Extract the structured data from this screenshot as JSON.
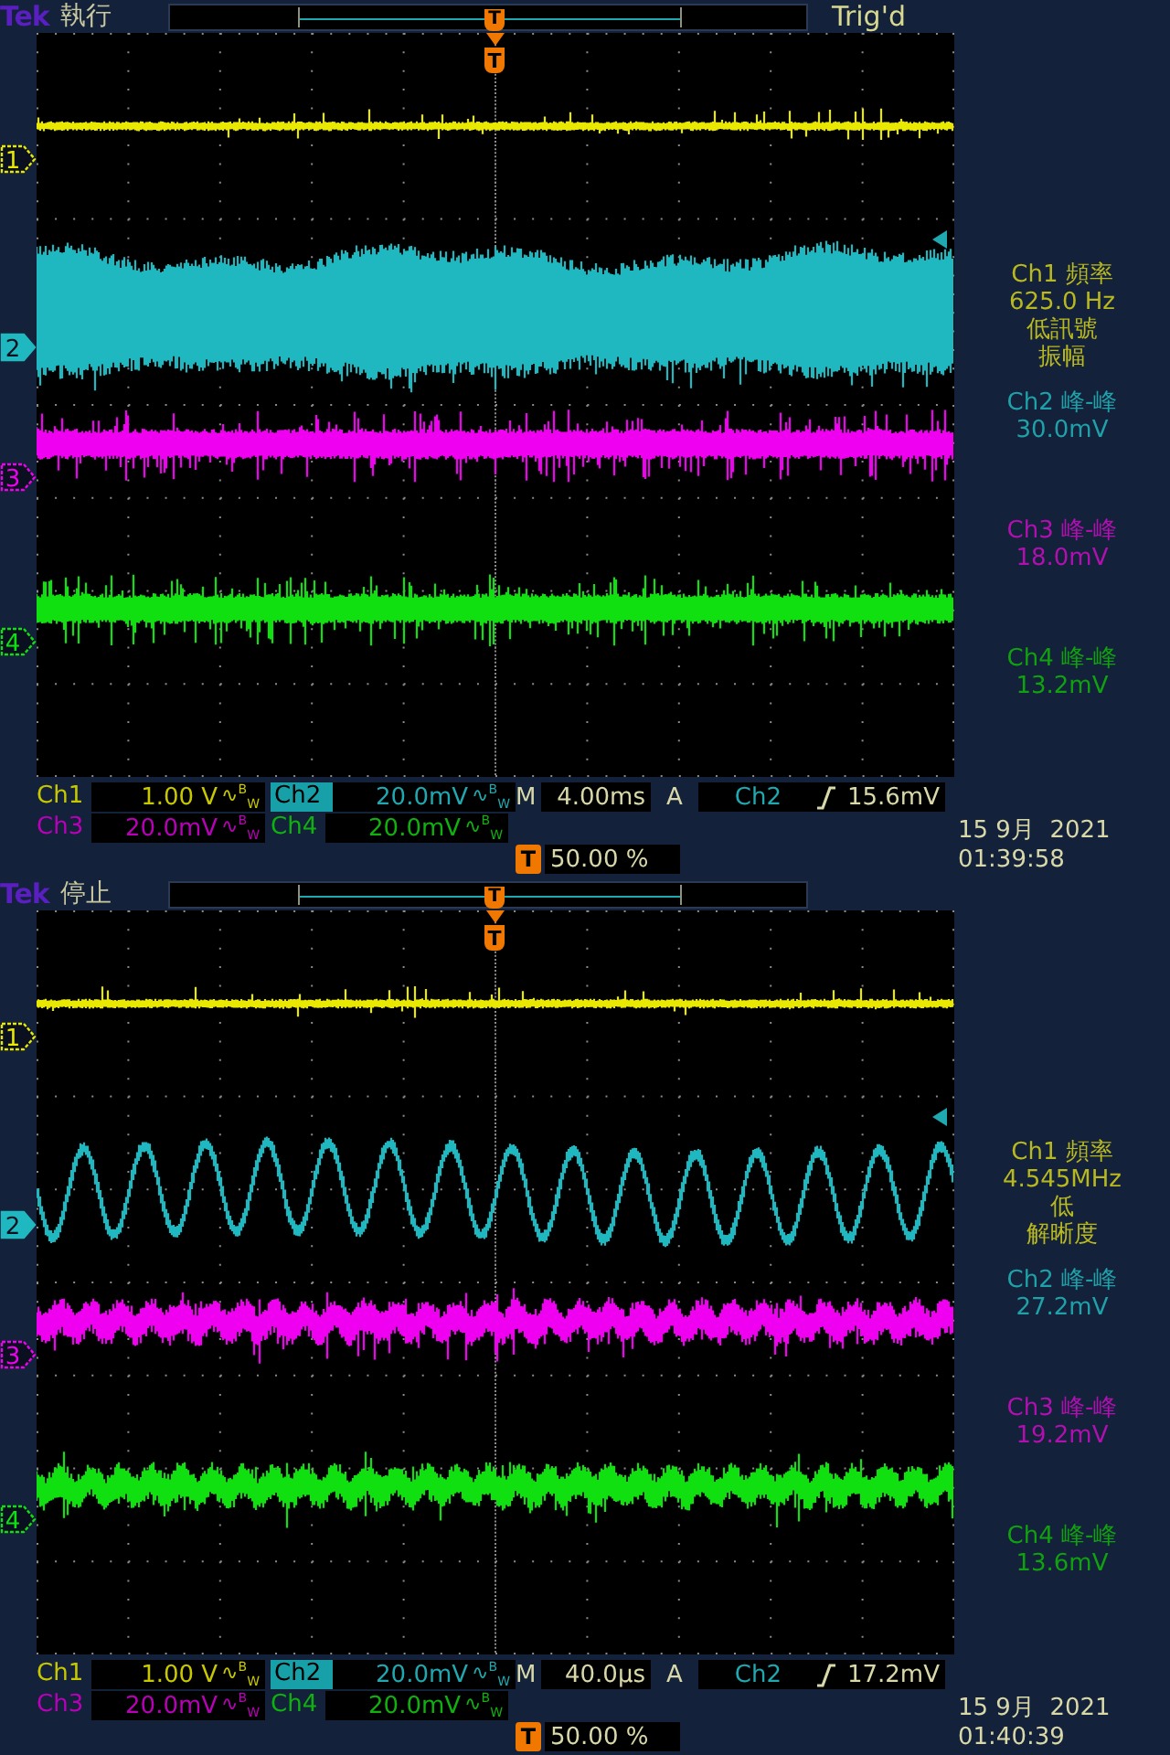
{
  "screens": [
    {
      "brand": "Tek",
      "run_state": "執行",
      "record_marker": "T",
      "trigger_marker": "T",
      "trigger_status": "Trig'd",
      "channels": [
        {
          "marker": "1",
          "color": "#e8e800",
          "selected": false,
          "kind": "thin"
        },
        {
          "marker": "2",
          "color": "#20b8c0",
          "selected": true,
          "kind": "band"
        },
        {
          "marker": "3",
          "color": "#f000f0",
          "selected": false,
          "kind": "thick"
        },
        {
          "marker": "4",
          "color": "#10e010",
          "selected": false,
          "kind": "thick"
        }
      ],
      "measurements": [
        {
          "heading": "Ch1 頻率",
          "lines": [
            "625.0 Hz",
            "低訊號",
            "振幅"
          ],
          "color": "#b8b820"
        },
        {
          "heading": "Ch2 峰-峰",
          "lines": [
            "30.0mV"
          ],
          "color": "#20a0a8"
        },
        {
          "heading": "Ch3 峰-峰",
          "lines": [
            "18.0mV"
          ],
          "color": "#b010b0"
        },
        {
          "heading": "Ch4 峰-峰",
          "lines": [
            "13.2mV"
          ],
          "color": "#10a010"
        }
      ],
      "vertical": [
        {
          "label": "Ch1",
          "scale": "1.00 V",
          "bw_limit": "∿$^{B}$$_{W}$",
          "selected": false,
          "color": "#c8c800"
        },
        {
          "label": "Ch2",
          "scale": "20.0mV",
          "bw_limit": "∿$^{B}$$_{W}$",
          "selected": true,
          "color": "#20a8b0"
        },
        {
          "label": "Ch3",
          "scale": "20.0mV",
          "bw_limit": "∿$^{B}$$_{W}$",
          "selected": false,
          "color": "#b800b8"
        },
        {
          "label": "Ch4",
          "scale": "20.0mV",
          "bw_limit": "∿$^{B}$$_{W}$",
          "selected": false,
          "color": "#10b010"
        }
      ],
      "horizontal": {
        "label": "M",
        "value": "4.00ms"
      },
      "trigger": {
        "label": "A",
        "source": "Ch2",
        "threshold": "15.6mV"
      },
      "trigger_position": {
        "marker": "T",
        "value": "50.00 %"
      },
      "date": "15 9月  2021",
      "time": "01:39:58"
    },
    {
      "brand": "Tek",
      "run_state": "停止",
      "record_marker": "T",
      "trigger_marker": "T",
      "channels": [
        {
          "marker": "1",
          "color": "#e8e800",
          "selected": false,
          "kind": "thin"
        },
        {
          "marker": "2",
          "color": "#20b8c0",
          "selected": true,
          "kind": "sine"
        },
        {
          "marker": "3",
          "color": "#f000f0",
          "selected": false,
          "kind": "ripple"
        },
        {
          "marker": "4",
          "color": "#10e010",
          "selected": false,
          "kind": "ripple"
        }
      ],
      "measurements": [
        {
          "heading": "Ch1 頻率",
          "lines": [
            "4.545MHz",
            "低",
            "解晰度"
          ],
          "color": "#b8b820"
        },
        {
          "heading": "Ch2 峰-峰",
          "lines": [
            "27.2mV"
          ],
          "color": "#20a0a8"
        },
        {
          "heading": "Ch3 峰-峰",
          "lines": [
            "19.2mV"
          ],
          "color": "#b010b0"
        },
        {
          "heading": "Ch4 峰-峰",
          "lines": [
            "13.6mV"
          ],
          "color": "#10a010"
        }
      ],
      "vertical": [
        {
          "label": "Ch1",
          "scale": "1.00 V",
          "bw_limit": "∿$^{B}$$_{W}$",
          "selected": false,
          "color": "#c8c800"
        },
        {
          "label": "Ch2",
          "scale": "20.0mV",
          "bw_limit": "∿$^{B}$$_{W}$",
          "selected": true,
          "color": "#20a8b0"
        },
        {
          "label": "Ch3",
          "scale": "20.0mV",
          "bw_limit": "∿$^{B}$$_{W}$",
          "selected": false,
          "color": "#b800b8"
        },
        {
          "label": "Ch4",
          "scale": "20.0mV",
          "bw_limit": "∿$^{B}$$_{W}$",
          "selected": false,
          "color": "#10b010"
        }
      ],
      "horizontal": {
        "label": "M",
        "value": "40.0µs"
      },
      "trigger": {
        "label": "A",
        "source": "Ch2",
        "threshold": "17.2mV"
      },
      "trigger_position": {
        "marker": "T",
        "value": "50.00 %"
      },
      "date": "15 9月  2021",
      "time": "01:40:39"
    }
  ]
}
